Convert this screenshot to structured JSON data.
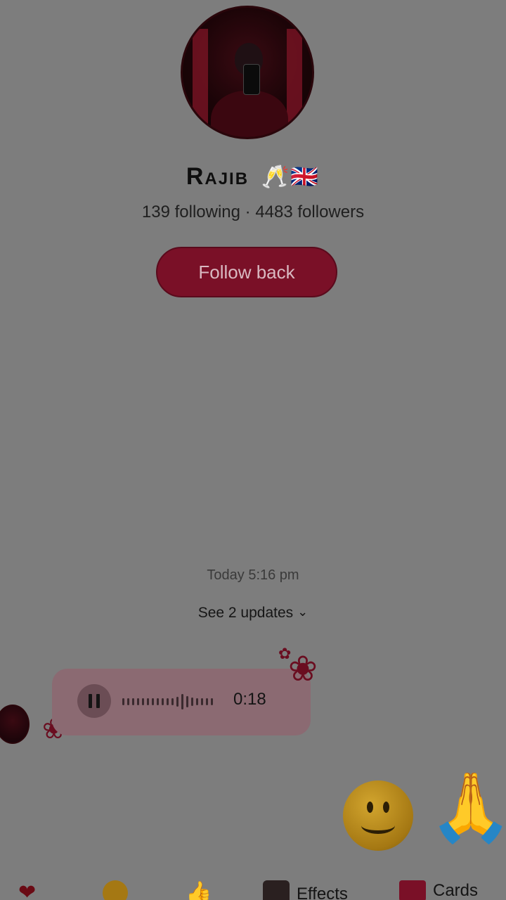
{
  "profile": {
    "name": "Rajib",
    "name_emoji": "🥂🇬🇧",
    "stats": "139 following · 4483 followers",
    "follow_label": "Follow back"
  },
  "chat": {
    "timestamp": "Today 5:16 pm",
    "updates_label": "See 2 updates",
    "voice_message": {
      "duration": "0:18",
      "state": "playing"
    }
  },
  "reactions": {
    "smile": "🙂",
    "pray": "🙏"
  },
  "quick_bar": {
    "heart": "❤",
    "thumbs": "👍",
    "effects_label": "Effects",
    "cards_label": "Cards"
  },
  "colors": {
    "accent": "#7a1027",
    "overlay_bg": "#7d7d7d"
  }
}
